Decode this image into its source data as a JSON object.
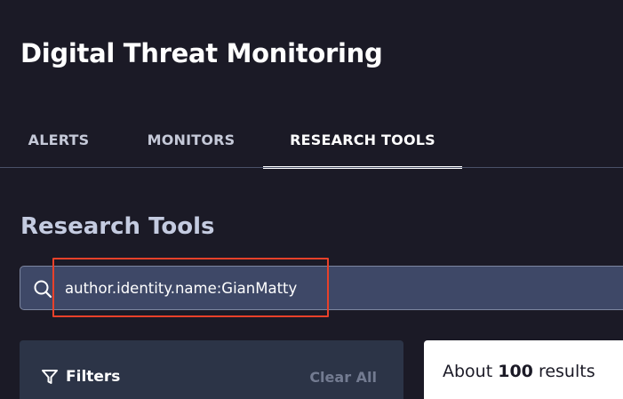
{
  "app": {
    "title": "Digital Threat Monitoring"
  },
  "tabs": [
    {
      "label": "ALERTS",
      "active": false
    },
    {
      "label": "MONITORS",
      "active": false
    },
    {
      "label": "RESEARCH TOOLS",
      "active": true
    }
  ],
  "section": {
    "title": "Research Tools"
  },
  "search": {
    "value": "author.identity.name:GianMatty",
    "icon": "search-icon"
  },
  "highlight": {
    "color": "#e8412a"
  },
  "filters": {
    "label": "Filters",
    "clear_label": "Clear All",
    "icon": "filter-icon"
  },
  "results": {
    "prefix": "About",
    "count": "100",
    "suffix": "results"
  },
  "colors": {
    "background": "#1b1a26",
    "search_bg": "#3e4867",
    "panel_bg": "#2c3447",
    "highlight": "#e8412a"
  }
}
